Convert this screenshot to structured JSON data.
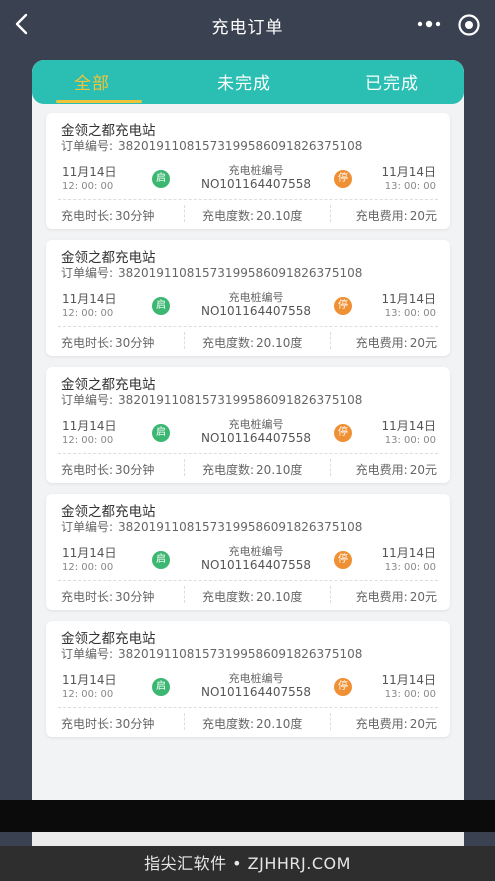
{
  "nav": {
    "title": "充电订单",
    "back_icon": "back-arrow-icon",
    "more_icon": "more-dots-icon",
    "target_icon": "target-icon"
  },
  "tabs": [
    {
      "label": "全部",
      "active": true
    },
    {
      "label": "未完成",
      "active": false
    },
    {
      "label": "已完成",
      "active": false
    }
  ],
  "colors": {
    "background": "#3a4150",
    "tab_bar": "#2bbfb3",
    "active_tab": "#f0c43a",
    "start_badge": "#3cb771",
    "stop_badge": "#f09035"
  },
  "orders": [
    {
      "station": "金领之都充电站",
      "order_label": "订单编号:",
      "order_no": "38201911081573199586091826375108",
      "start_date": "11月14日",
      "start_time": "12: 00: 00",
      "start_badge": "启",
      "pile_label": "充电桩编号",
      "pile_no": "NO101164407558",
      "stop_badge": "停",
      "end_date": "11月14日",
      "end_time": "13: 00: 00",
      "duration_label": "充电时长:",
      "duration": "30分钟",
      "degree_label": "充电度数:",
      "degree": "20.10度",
      "fee_label": "充电费用:",
      "fee": "20元"
    },
    {
      "station": "金领之都充电站",
      "order_label": "订单编号:",
      "order_no": "38201911081573199586091826375108",
      "start_date": "11月14日",
      "start_time": "12: 00: 00",
      "start_badge": "启",
      "pile_label": "充电桩编号",
      "pile_no": "NO101164407558",
      "stop_badge": "停",
      "end_date": "11月14日",
      "end_time": "13: 00: 00",
      "duration_label": "充电时长:",
      "duration": "30分钟",
      "degree_label": "充电度数:",
      "degree": "20.10度",
      "fee_label": "充电费用:",
      "fee": "20元"
    },
    {
      "station": "金领之都充电站",
      "order_label": "订单编号:",
      "order_no": "38201911081573199586091826375108",
      "start_date": "11月14日",
      "start_time": "12: 00: 00",
      "start_badge": "启",
      "pile_label": "充电桩编号",
      "pile_no": "NO101164407558",
      "stop_badge": "停",
      "end_date": "11月14日",
      "end_time": "13: 00: 00",
      "duration_label": "充电时长:",
      "duration": "30分钟",
      "degree_label": "充电度数:",
      "degree": "20.10度",
      "fee_label": "充电费用:",
      "fee": "20元"
    },
    {
      "station": "金领之都充电站",
      "order_label": "订单编号:",
      "order_no": "38201911081573199586091826375108",
      "start_date": "11月14日",
      "start_time": "12: 00: 00",
      "start_badge": "启",
      "pile_label": "充电桩编号",
      "pile_no": "NO101164407558",
      "stop_badge": "停",
      "end_date": "11月14日",
      "end_time": "13: 00: 00",
      "duration_label": "充电时长:",
      "duration": "30分钟",
      "degree_label": "充电度数:",
      "degree": "20.10度",
      "fee_label": "充电费用:",
      "fee": "20元"
    },
    {
      "station": "金领之都充电站",
      "order_label": "订单编号:",
      "order_no": "38201911081573199586091826375108",
      "start_date": "11月14日",
      "start_time": "12: 00: 00",
      "start_badge": "启",
      "pile_label": "充电桩编号",
      "pile_no": "NO101164407558",
      "stop_badge": "停",
      "end_date": "11月14日",
      "end_time": "13: 00: 00",
      "duration_label": "充电时长:",
      "duration": "30分钟",
      "degree_label": "充电度数:",
      "degree": "20.10度",
      "fee_label": "充电费用:",
      "fee": "20元"
    }
  ],
  "watermark": "指尖汇软件 • ZJHHRJ.COM"
}
